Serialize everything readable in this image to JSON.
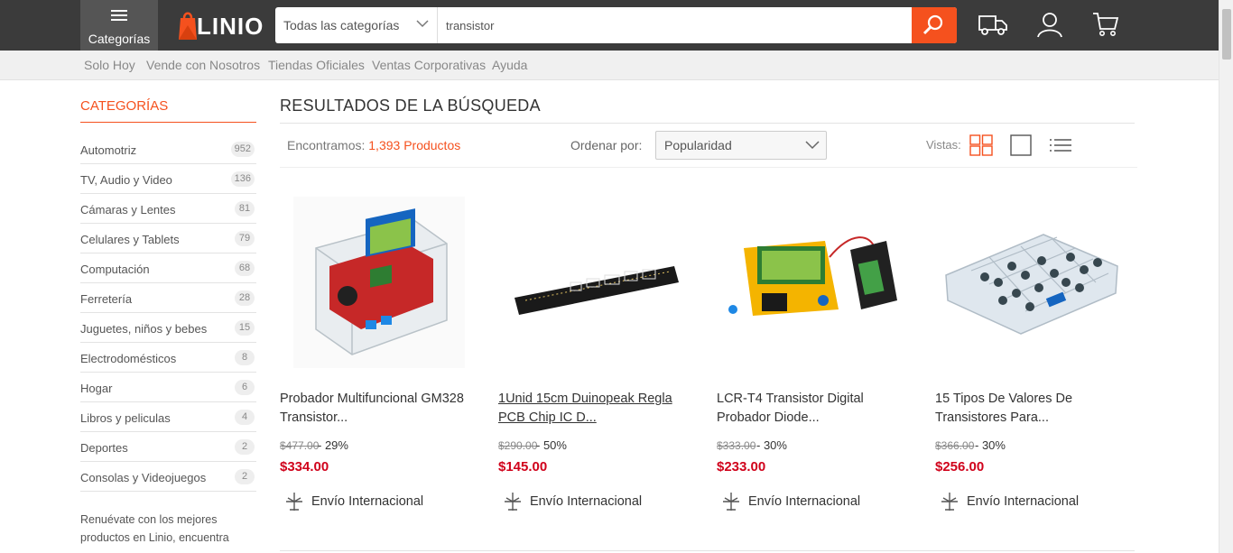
{
  "header": {
    "categories_label": "Categorías",
    "logo_text": "LINIO",
    "search": {
      "category": "Todas las categorías",
      "query": "transistor"
    },
    "icons": [
      "shipping-truck-icon",
      "user-icon",
      "cart-icon"
    ]
  },
  "subnav": {
    "links": [
      "Solo Hoy",
      "Vende con Nosotros",
      "Tiendas Oficiales",
      "Ventas Corporativas",
      "Ayuda"
    ]
  },
  "sidebar": {
    "title": "CATEGORÍAS",
    "items": [
      {
        "label": "Automotriz",
        "count": "952"
      },
      {
        "label": "TV, Audio y Video",
        "count": "136"
      },
      {
        "label": "Cámaras y Lentes",
        "count": "81"
      },
      {
        "label": "Celulares y Tablets",
        "count": "79"
      },
      {
        "label": "Computación",
        "count": "68"
      },
      {
        "label": "Ferretería",
        "count": "28"
      },
      {
        "label": "Juguetes, niños y bebes",
        "count": "15"
      },
      {
        "label": "Electrodomésticos",
        "count": "8"
      },
      {
        "label": "Hogar",
        "count": "6"
      },
      {
        "label": "Libros y peliculas",
        "count": "4"
      },
      {
        "label": "Deportes",
        "count": "2"
      },
      {
        "label": "Consolas y Videojuegos",
        "count": "2"
      }
    ],
    "promo_text": "Renuévate con los mejores productos en Linio, encuentra"
  },
  "results": {
    "title": "RESULTADOS DE LA BÚSQUEDA",
    "found_label": "Encontramos:",
    "found_count": "1,393 Productos",
    "sort_label": "Ordenar por:",
    "sort_value": "Popularidad",
    "views_label": "Vistas:"
  },
  "products": [
    {
      "title": "Probador Multifuncional GM328 Transistor...",
      "old_price": "$477.00",
      "discount": "- 29%",
      "price": "$334.00",
      "shipping": "Envío Internacional"
    },
    {
      "title": "1Unid 15cm Duinopeak Regla PCB Chip IC D...",
      "old_price": "$290.00",
      "discount": "- 50%",
      "price": "$145.00",
      "shipping": "Envío Internacional"
    },
    {
      "title": "LCR-T4 Transistor Digital Probador Diode...",
      "old_price": "$333.00",
      "discount": "- 30%",
      "price": "$233.00",
      "shipping": "Envío Internacional"
    },
    {
      "title": "15 Tipos De Valores De Transistores Para...",
      "old_price": "$366.00",
      "discount": "- 30%",
      "price": "$256.00",
      "shipping": "Envío Internacional"
    }
  ],
  "colors": {
    "brand_orange": "#f5511e",
    "header_bg": "#3b3b3b",
    "price_red": "#d0021b"
  }
}
